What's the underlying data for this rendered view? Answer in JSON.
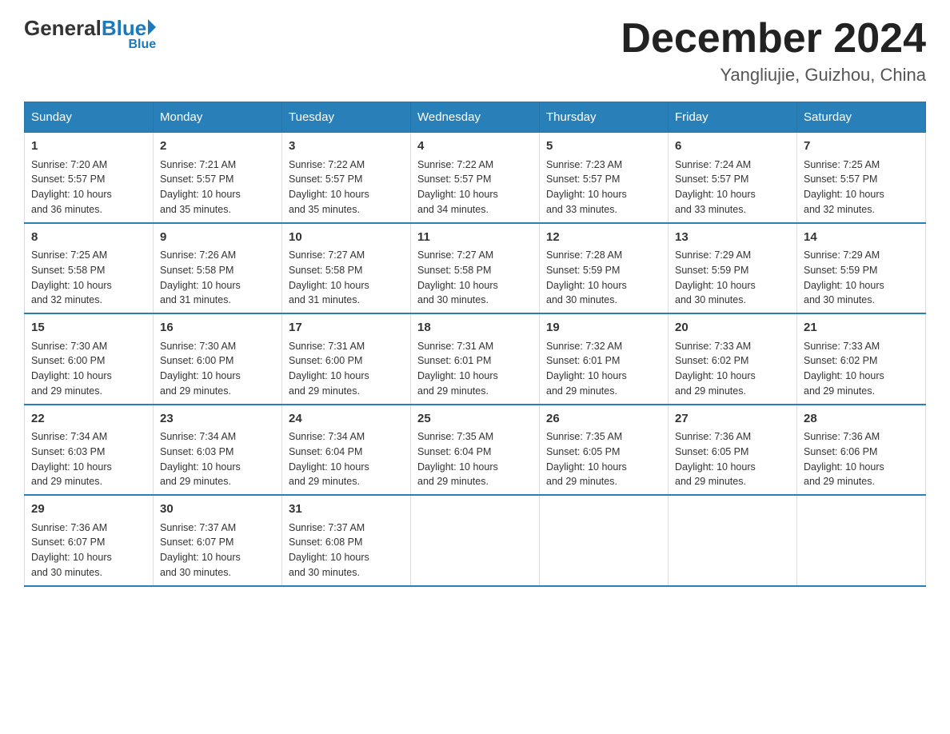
{
  "header": {
    "logo_general": "General",
    "logo_blue": "Blue",
    "month_title": "December 2024",
    "location": "Yangliujie, Guizhou, China"
  },
  "days_of_week": [
    "Sunday",
    "Monday",
    "Tuesday",
    "Wednesday",
    "Thursday",
    "Friday",
    "Saturday"
  ],
  "weeks": [
    [
      {
        "day": "1",
        "sunrise": "7:20 AM",
        "sunset": "5:57 PM",
        "daylight": "10 hours and 36 minutes."
      },
      {
        "day": "2",
        "sunrise": "7:21 AM",
        "sunset": "5:57 PM",
        "daylight": "10 hours and 35 minutes."
      },
      {
        "day": "3",
        "sunrise": "7:22 AM",
        "sunset": "5:57 PM",
        "daylight": "10 hours and 35 minutes."
      },
      {
        "day": "4",
        "sunrise": "7:22 AM",
        "sunset": "5:57 PM",
        "daylight": "10 hours and 34 minutes."
      },
      {
        "day": "5",
        "sunrise": "7:23 AM",
        "sunset": "5:57 PM",
        "daylight": "10 hours and 33 minutes."
      },
      {
        "day": "6",
        "sunrise": "7:24 AM",
        "sunset": "5:57 PM",
        "daylight": "10 hours and 33 minutes."
      },
      {
        "day": "7",
        "sunrise": "7:25 AM",
        "sunset": "5:57 PM",
        "daylight": "10 hours and 32 minutes."
      }
    ],
    [
      {
        "day": "8",
        "sunrise": "7:25 AM",
        "sunset": "5:58 PM",
        "daylight": "10 hours and 32 minutes."
      },
      {
        "day": "9",
        "sunrise": "7:26 AM",
        "sunset": "5:58 PM",
        "daylight": "10 hours and 31 minutes."
      },
      {
        "day": "10",
        "sunrise": "7:27 AM",
        "sunset": "5:58 PM",
        "daylight": "10 hours and 31 minutes."
      },
      {
        "day": "11",
        "sunrise": "7:27 AM",
        "sunset": "5:58 PM",
        "daylight": "10 hours and 30 minutes."
      },
      {
        "day": "12",
        "sunrise": "7:28 AM",
        "sunset": "5:59 PM",
        "daylight": "10 hours and 30 minutes."
      },
      {
        "day": "13",
        "sunrise": "7:29 AM",
        "sunset": "5:59 PM",
        "daylight": "10 hours and 30 minutes."
      },
      {
        "day": "14",
        "sunrise": "7:29 AM",
        "sunset": "5:59 PM",
        "daylight": "10 hours and 30 minutes."
      }
    ],
    [
      {
        "day": "15",
        "sunrise": "7:30 AM",
        "sunset": "6:00 PM",
        "daylight": "10 hours and 29 minutes."
      },
      {
        "day": "16",
        "sunrise": "7:30 AM",
        "sunset": "6:00 PM",
        "daylight": "10 hours and 29 minutes."
      },
      {
        "day": "17",
        "sunrise": "7:31 AM",
        "sunset": "6:00 PM",
        "daylight": "10 hours and 29 minutes."
      },
      {
        "day": "18",
        "sunrise": "7:31 AM",
        "sunset": "6:01 PM",
        "daylight": "10 hours and 29 minutes."
      },
      {
        "day": "19",
        "sunrise": "7:32 AM",
        "sunset": "6:01 PM",
        "daylight": "10 hours and 29 minutes."
      },
      {
        "day": "20",
        "sunrise": "7:33 AM",
        "sunset": "6:02 PM",
        "daylight": "10 hours and 29 minutes."
      },
      {
        "day": "21",
        "sunrise": "7:33 AM",
        "sunset": "6:02 PM",
        "daylight": "10 hours and 29 minutes."
      }
    ],
    [
      {
        "day": "22",
        "sunrise": "7:34 AM",
        "sunset": "6:03 PM",
        "daylight": "10 hours and 29 minutes."
      },
      {
        "day": "23",
        "sunrise": "7:34 AM",
        "sunset": "6:03 PM",
        "daylight": "10 hours and 29 minutes."
      },
      {
        "day": "24",
        "sunrise": "7:34 AM",
        "sunset": "6:04 PM",
        "daylight": "10 hours and 29 minutes."
      },
      {
        "day": "25",
        "sunrise": "7:35 AM",
        "sunset": "6:04 PM",
        "daylight": "10 hours and 29 minutes."
      },
      {
        "day": "26",
        "sunrise": "7:35 AM",
        "sunset": "6:05 PM",
        "daylight": "10 hours and 29 minutes."
      },
      {
        "day": "27",
        "sunrise": "7:36 AM",
        "sunset": "6:05 PM",
        "daylight": "10 hours and 29 minutes."
      },
      {
        "day": "28",
        "sunrise": "7:36 AM",
        "sunset": "6:06 PM",
        "daylight": "10 hours and 29 minutes."
      }
    ],
    [
      {
        "day": "29",
        "sunrise": "7:36 AM",
        "sunset": "6:07 PM",
        "daylight": "10 hours and 30 minutes."
      },
      {
        "day": "30",
        "sunrise": "7:37 AM",
        "sunset": "6:07 PM",
        "daylight": "10 hours and 30 minutes."
      },
      {
        "day": "31",
        "sunrise": "7:37 AM",
        "sunset": "6:08 PM",
        "daylight": "10 hours and 30 minutes."
      },
      {
        "day": "",
        "sunrise": "",
        "sunset": "",
        "daylight": ""
      },
      {
        "day": "",
        "sunrise": "",
        "sunset": "",
        "daylight": ""
      },
      {
        "day": "",
        "sunrise": "",
        "sunset": "",
        "daylight": ""
      },
      {
        "day": "",
        "sunrise": "",
        "sunset": "",
        "daylight": ""
      }
    ]
  ],
  "labels": {
    "sunrise_prefix": "Sunrise: ",
    "sunset_prefix": "Sunset: ",
    "daylight_prefix": "Daylight: "
  }
}
